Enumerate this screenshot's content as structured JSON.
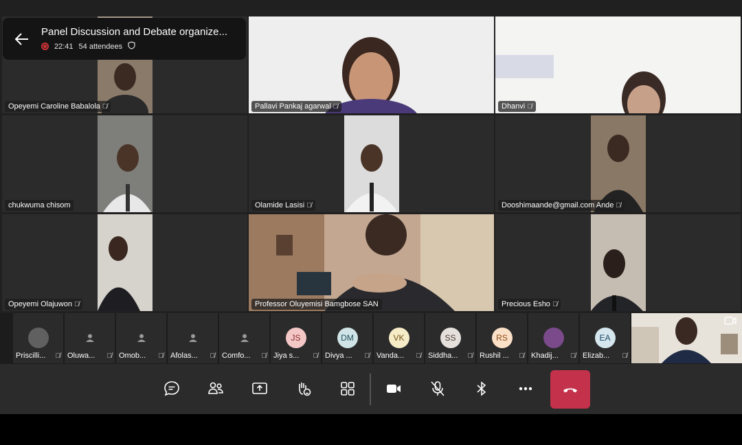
{
  "meeting": {
    "title": "Panel Discussion and Debate organize...",
    "duration": "22:41",
    "attendees": "54 attendees"
  },
  "tiles": [
    {
      "name": "Opeyemi Caroline Babalola"
    },
    {
      "name": "Pallavi Pankaj agarwal"
    },
    {
      "name": "Dhanvi"
    },
    {
      "name": "chukwuma chisom"
    },
    {
      "name": "Olamide Lasisi"
    },
    {
      "name": "Dooshimaande@gmail.com Ande"
    },
    {
      "name": "Opeyemi Olajuwon"
    },
    {
      "name": "Professor Oluyemisi Bamgbose SAN"
    },
    {
      "name": "Precious Esho"
    }
  ],
  "roster": [
    {
      "name": "Priscilli...",
      "initials": ""
    },
    {
      "name": "Oluwa...",
      "initials": ""
    },
    {
      "name": "Omob...",
      "initials": ""
    },
    {
      "name": "Afolas...",
      "initials": ""
    },
    {
      "name": "Comfo...",
      "initials": ""
    },
    {
      "name": "Jiya s...",
      "initials": "JS"
    },
    {
      "name": "Divya ...",
      "initials": "DM"
    },
    {
      "name": "Vanda...",
      "initials": "VK"
    },
    {
      "name": "Siddha...",
      "initials": "SS"
    },
    {
      "name": "Rushil ...",
      "initials": "RS"
    },
    {
      "name": "Khadij...",
      "initials": ""
    },
    {
      "name": "Elizab...",
      "initials": "EA"
    }
  ],
  "colors": {
    "accent": "#7b83eb",
    "leave": "#c4314b",
    "recording": "#d13438"
  },
  "icons": {
    "controls": [
      "chat-icon",
      "people-icon",
      "share-screen-icon",
      "raise-hand-icon",
      "view-grid-icon",
      "camera-icon",
      "mic-off-icon",
      "bluetooth-icon",
      "more-icon",
      "hang-up-icon"
    ]
  }
}
